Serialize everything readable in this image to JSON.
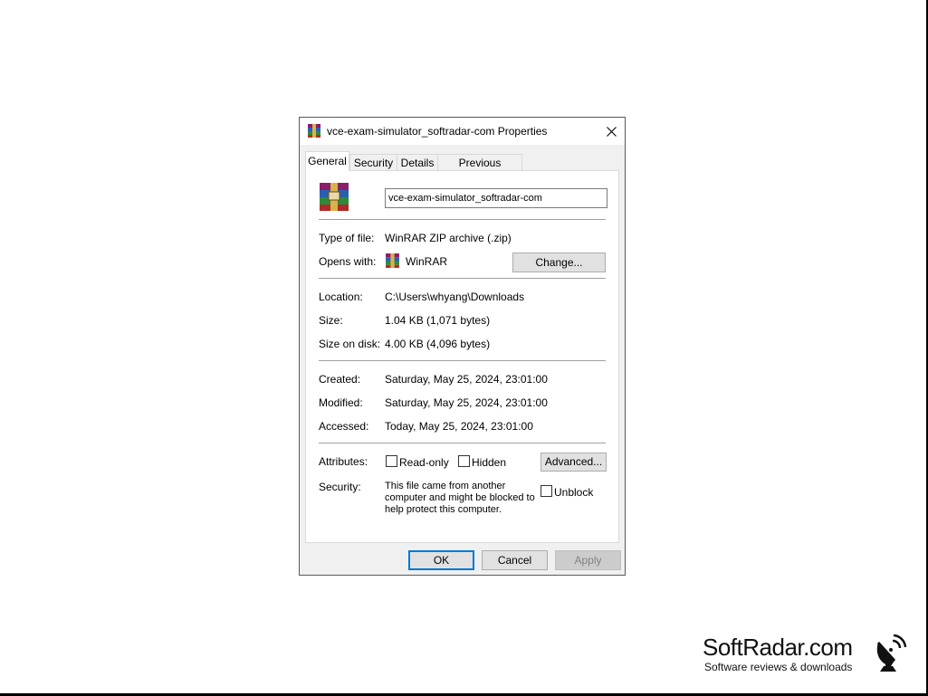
{
  "window": {
    "title": "vce-exam-simulator_softradar-com Properties",
    "close_glyph": "✕"
  },
  "tabs": [
    {
      "label": "General",
      "active": true
    },
    {
      "label": "Security",
      "active": false
    },
    {
      "label": "Details",
      "active": false
    },
    {
      "label": "Previous Versions",
      "active": false
    }
  ],
  "general": {
    "file_name": "vce-exam-simulator_softradar-com",
    "type_label": "Type of file:",
    "type_value": "WinRAR ZIP archive (.zip)",
    "opens_label": "Opens with:",
    "opens_value": "WinRAR",
    "change_button": "Change...",
    "location_label": "Location:",
    "location_value": "C:\\Users\\whyang\\Downloads",
    "size_label": "Size:",
    "size_value": "1.04 KB (1,071 bytes)",
    "size_on_disk_label": "Size on disk:",
    "size_on_disk_value": "4.00 KB (4,096 bytes)",
    "created_label": "Created:",
    "created_value": "Saturday, May 25, 2024, 23:01:00",
    "modified_label": "Modified:",
    "modified_value": "Saturday, May 25, 2024, 23:01:00",
    "accessed_label": "Accessed:",
    "accessed_value": "Today, May 25, 2024, 23:01:00",
    "attributes_label": "Attributes:",
    "readonly_label": "Read-only",
    "readonly_checked": false,
    "hidden_label": "Hidden",
    "hidden_checked": false,
    "advanced_button": "Advanced...",
    "security_label": "Security:",
    "security_text": "This file came from another computer and might be blocked to help protect this computer.",
    "unblock_label": "Unblock",
    "unblock_checked": false
  },
  "footer": {
    "ok": "OK",
    "cancel": "Cancel",
    "apply": "Apply"
  },
  "watermark": {
    "name": "SoftRadar.com",
    "tagline": "Software reviews & downloads"
  },
  "colors": {
    "accent": "#0078d7",
    "dialog_bg": "#f0f0f0",
    "panel_bg": "#ffffff"
  },
  "icons": {
    "file": "winrar-archive-icon",
    "app": "winrar-icon",
    "close": "close-icon",
    "brand": "satellite-dish-icon"
  }
}
